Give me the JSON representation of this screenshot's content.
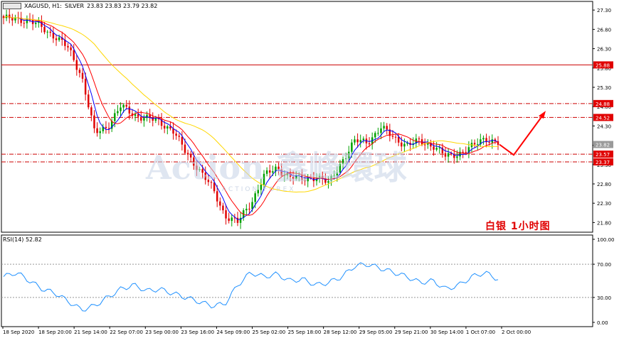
{
  "header": {
    "symbol": "XAGUSD, H1:",
    "name": "SILVER",
    "ohlc": "23.83 23.83 23.79 23.82"
  },
  "watermark": {
    "main": "Action 鑫峰環球",
    "sub": "ACTION FOREX"
  },
  "annotation": {
    "label": "白银  1小时图",
    "arrow_color": "#ff0000"
  },
  "colors": {
    "bull": "#00a000",
    "bear": "#e00000",
    "ma_fast": "#0000ff",
    "ma_mid": "#ff0000",
    "ma_slow": "#ffd700",
    "rsi": "#1e90ff",
    "level_line": "#cc0000"
  },
  "price_axis": {
    "ticks": [
      "27.30",
      "26.80",
      "26.30",
      "25.80",
      "25.30",
      "24.80",
      "24.30",
      "23.80",
      "23.30",
      "22.80",
      "22.30",
      "21.80"
    ],
    "tags": [
      {
        "label": "25.88",
        "value": 25.88,
        "style": "solid",
        "tag": "red"
      },
      {
        "label": "24.88",
        "value": 24.88,
        "style": "dashdot",
        "tag": "red"
      },
      {
        "label": "24.52",
        "value": 24.52,
        "style": "dashdot",
        "tag": "red"
      },
      {
        "label": "23.82",
        "value": 23.82,
        "style": "none",
        "tag": "gray"
      },
      {
        "label": "23.57",
        "value": 23.57,
        "style": "dashdot",
        "tag": "red"
      },
      {
        "label": "23.37",
        "value": 23.37,
        "style": "dashdot",
        "tag": "red"
      }
    ]
  },
  "rsi_panel": {
    "title": "RSI(14) 52.82",
    "ticks": [
      "100.00",
      "70.00",
      "30.00",
      "0.00"
    ],
    "levels": [
      70,
      30
    ]
  },
  "time_axis": [
    "18 Sep 2020",
    "18 Sep 20:00",
    "21 Sep 14:00",
    "22 Sep 07:00",
    "23 Sep 00:00",
    "23 Sep 16:00",
    "24 Sep 09:00",
    "25 Sep 02:00",
    "25 Sep 18:00",
    "28 Sep 12:00",
    "29 Sep 05:00",
    "29 Sep 21:00",
    "30 Sep 14:00",
    "1 Oct 07:00",
    "2 Oct 00:00"
  ],
  "chart_data": {
    "type": "candlestick",
    "instrument": "XAGUSD H1 SILVER",
    "ylim": [
      21.55,
      27.45
    ],
    "anchor_closes": [
      27.05,
      27.1,
      27.0,
      26.85,
      26.6,
      26.3,
      25.6,
      24.1,
      24.3,
      24.8,
      24.6,
      24.5,
      24.4,
      24.2,
      23.6,
      23.2,
      22.7,
      22.0,
      21.8,
      22.3,
      23.0,
      23.2,
      23.0,
      22.9,
      23.0,
      22.8,
      23.4,
      23.9,
      23.9,
      24.25,
      24.0,
      23.8,
      23.9,
      23.8,
      23.5,
      23.6,
      23.75,
      24.0,
      23.85
    ],
    "rsi_anchor": [
      55,
      60,
      50,
      40,
      35,
      25,
      15,
      20,
      30,
      40,
      45,
      38,
      40,
      35,
      30,
      25,
      20,
      22,
      45,
      60,
      55,
      58,
      50,
      52,
      45,
      48,
      55,
      68,
      70,
      65,
      60,
      55,
      48,
      50,
      40,
      45,
      55,
      60,
      52
    ]
  }
}
